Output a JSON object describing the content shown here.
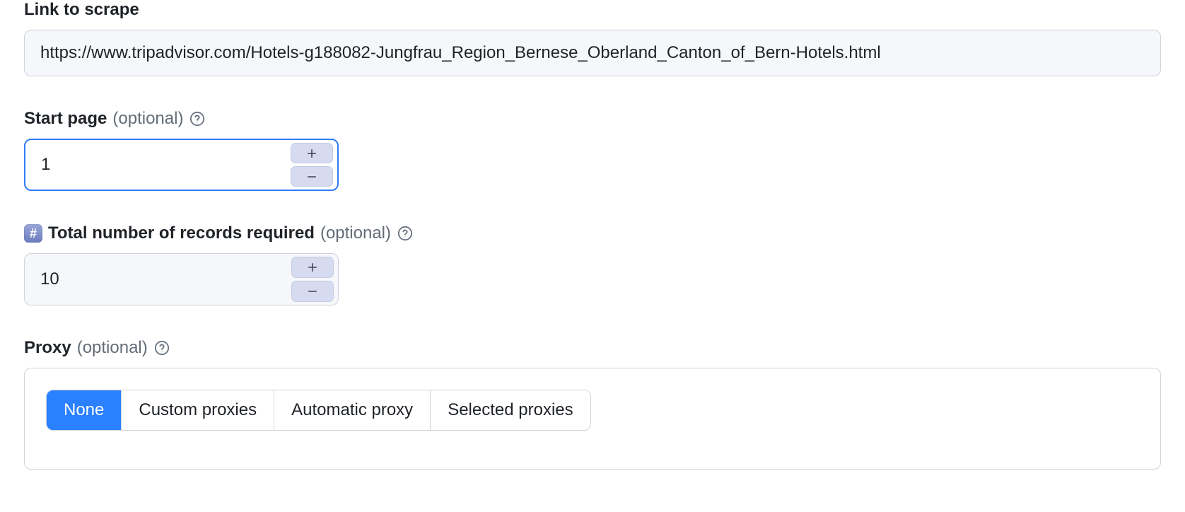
{
  "link": {
    "label": "Link to scrape",
    "value": "https://www.tripadvisor.com/Hotels-g188082-Jungfrau_Region_Bernese_Oberland_Canton_of_Bern-Hotels.html"
  },
  "start_page": {
    "label": "Start page",
    "optional": "(optional)",
    "value": "1"
  },
  "total_records": {
    "label": "Total number of records required",
    "optional": "(optional)",
    "value": "10"
  },
  "proxy": {
    "label": "Proxy",
    "optional": "(optional)",
    "options": [
      "None",
      "Custom proxies",
      "Automatic proxy",
      "Selected proxies"
    ],
    "selected_index": 0
  }
}
